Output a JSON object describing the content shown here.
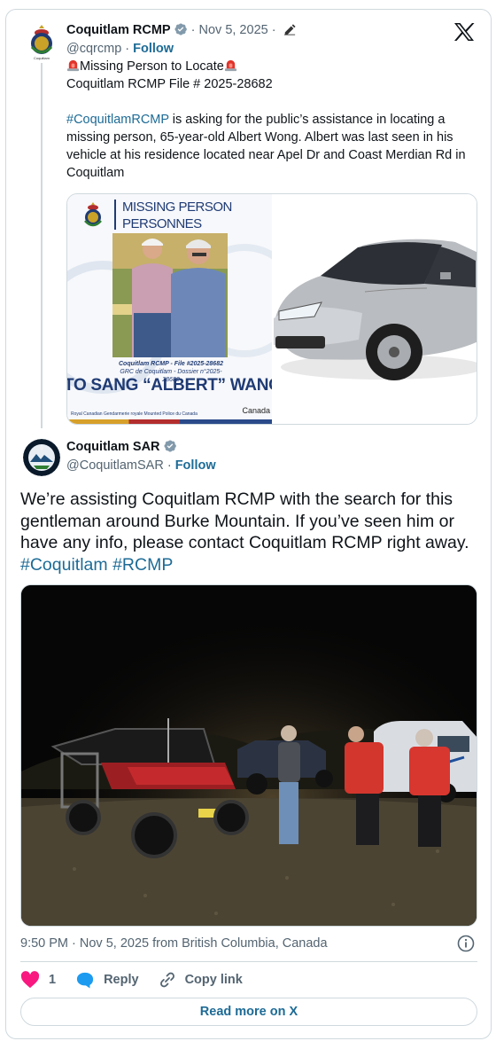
{
  "quoted": {
    "author_name": "Coquitlam RCMP",
    "date": "Nov 5, 2025",
    "handle": "@cqrcmp",
    "follow_label": "Follow",
    "title_line": "Missing Person to Locate",
    "file_line": "Coquitlam RCMP File # 2025-28682",
    "hashtag": "#CoquitlamRCMP",
    "body": " is asking for the public’s assistance in locating a missing person, 65-year-old Albert Wong. Albert was last seen in his vehicle at his residence located near Apel Dr and Coast Merdian Rd in Coquitlam",
    "poster": {
      "title_en": "MISSING PERSON",
      "title_fr": "PERSONNES DISPARUES",
      "file_en": "Coquitlam RCMP - File #2025-28682",
      "file_fr": "GRC de Coquitlam - Dossier n°2025-28682",
      "name": "TO SANG “ALBERT” WANG",
      "footer": "Royal Canadian   Gendarmerie royale\nMounted Police   du Canada",
      "canada": "Canada"
    }
  },
  "main": {
    "author_name": "Coquitlam SAR",
    "handle": "@CoquitlamSAR",
    "follow_label": "Follow",
    "body": "We’re assisting Coquitlam RCMP with the search for this gentleman around Burke Mountain. If you’ve seen him or have any info, please contact Coquitlam RCMP right away. ",
    "hashtag_1": "#Coquitlam",
    "hashtag_2": "#RCMP",
    "timestamp": "9:50 PM · Nov 5, 2025 from British Columbia, Canada"
  },
  "actions": {
    "like_count": "1",
    "reply_label": "Reply",
    "copy_label": "Copy link",
    "read_more_label": "Read more on X"
  },
  "colors": {
    "link": "#1d6b96",
    "muted": "#536471",
    "border": "#cfd9de",
    "like": "#f91880",
    "verified": "#829aab"
  }
}
